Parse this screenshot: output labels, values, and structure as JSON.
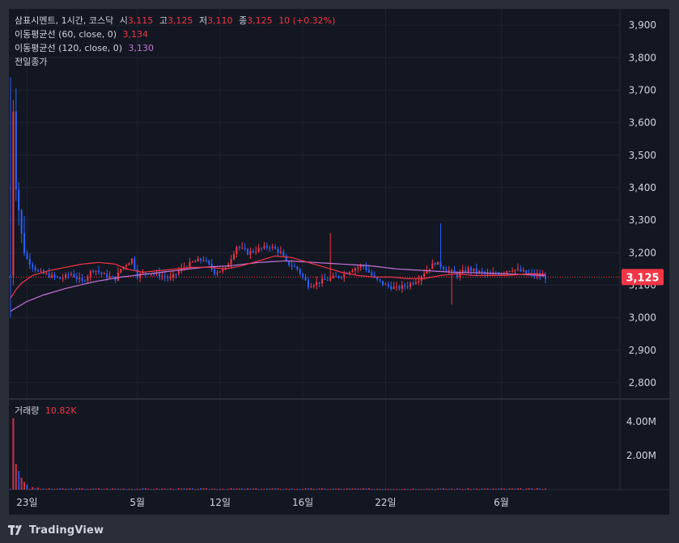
{
  "header": {
    "symbol_line": "삼표시멘트, 1시간, 코스닥",
    "open_label": "시",
    "open_value": "3,115",
    "high_label": "고",
    "high_value": "3,125",
    "low_label": "저",
    "low_value": "3,110",
    "close_label": "종",
    "close_value": "3,125",
    "change": "10 (+0.32%)"
  },
  "indicators": {
    "ma60_label": "이동평균선 (60, close, 0)",
    "ma60_value": "3,134",
    "ma120_label": "이동평균선 (120, close, 0)",
    "ma120_value": "3,130",
    "prev_close_label": "전일종가"
  },
  "volume": {
    "label": "거래량",
    "value": "10.82K"
  },
  "branding": {
    "name": "TradingView"
  },
  "colors": {
    "up": "#f23645",
    "down": "#2962ff",
    "ma60": "#f23645",
    "ma120": "#c573d9"
  },
  "chart_data": {
    "type": "candlestick",
    "price_axis": {
      "ticks": [
        "3,900",
        "3,800",
        "3,700",
        "3,600",
        "3,500",
        "3,400",
        "3,300",
        "3,200",
        "3,100",
        "3,000",
        "2,900",
        "2,800"
      ],
      "range": [
        2750,
        3950
      ]
    },
    "current_price_label": "3,125",
    "current_price": 3125,
    "volume_axis": {
      "ticks": [
        "4.00M",
        "2.00M"
      ],
      "range": [
        0,
        5000000
      ]
    },
    "time_axis": {
      "labels": [
        "23일",
        "5월",
        "12일",
        "16일",
        "22일",
        "6월"
      ]
    },
    "key_levels": {
      "prev_close": 3125
    },
    "price_path": [
      [
        0,
        3130
      ],
      [
        1,
        3650
      ],
      [
        2,
        3420
      ],
      [
        4,
        3250
      ],
      [
        6,
        3180
      ],
      [
        10,
        3140
      ],
      [
        14,
        3130
      ],
      [
        18,
        3120
      ],
      [
        22,
        3135
      ],
      [
        26,
        3110
      ],
      [
        30,
        3150
      ],
      [
        34,
        3130
      ],
      [
        38,
        3120
      ],
      [
        40,
        3150
      ],
      [
        44,
        3180
      ],
      [
        46,
        3130
      ],
      [
        50,
        3140
      ],
      [
        54,
        3130
      ],
      [
        58,
        3120
      ],
      [
        62,
        3150
      ],
      [
        66,
        3170
      ],
      [
        70,
        3180
      ],
      [
        74,
        3140
      ],
      [
        78,
        3150
      ],
      [
        82,
        3220
      ],
      [
        86,
        3200
      ],
      [
        90,
        3210
      ],
      [
        94,
        3220
      ],
      [
        98,
        3200
      ],
      [
        100,
        3170
      ],
      [
        104,
        3150
      ],
      [
        108,
        3100
      ],
      [
        112,
        3110
      ],
      [
        116,
        3120
      ],
      [
        120,
        3130
      ],
      [
        124,
        3150
      ],
      [
        128,
        3160
      ],
      [
        132,
        3120
      ],
      [
        136,
        3100
      ],
      [
        140,
        3090
      ],
      [
        144,
        3100
      ],
      [
        148,
        3120
      ],
      [
        150,
        3140
      ],
      [
        154,
        3170
      ],
      [
        158,
        3150
      ],
      [
        162,
        3130
      ],
      [
        166,
        3150
      ],
      [
        170,
        3140
      ],
      [
        174,
        3130
      ],
      [
        178,
        3140
      ],
      [
        182,
        3150
      ],
      [
        186,
        3140
      ],
      [
        190,
        3130
      ],
      [
        194,
        3125
      ]
    ],
    "ma60_path": [
      [
        0,
        3060
      ],
      [
        3,
        3100
      ],
      [
        8,
        3130
      ],
      [
        14,
        3145
      ],
      [
        20,
        3155
      ],
      [
        26,
        3165
      ],
      [
        32,
        3170
      ],
      [
        38,
        3165
      ],
      [
        42,
        3150
      ],
      [
        48,
        3140
      ],
      [
        54,
        3145
      ],
      [
        60,
        3150
      ],
      [
        66,
        3155
      ],
      [
        72,
        3155
      ],
      [
        78,
        3150
      ],
      [
        84,
        3160
      ],
      [
        90,
        3175
      ],
      [
        96,
        3190
      ],
      [
        102,
        3185
      ],
      [
        108,
        3170
      ],
      [
        114,
        3155
      ],
      [
        120,
        3140
      ],
      [
        126,
        3130
      ],
      [
        132,
        3125
      ],
      [
        138,
        3125
      ],
      [
        144,
        3120
      ],
      [
        150,
        3120
      ],
      [
        156,
        3130
      ],
      [
        162,
        3135
      ],
      [
        168,
        3130
      ],
      [
        174,
        3130
      ],
      [
        180,
        3130
      ],
      [
        188,
        3135
      ],
      [
        194,
        3134
      ]
    ],
    "ma120_path": [
      [
        0,
        3020
      ],
      [
        6,
        3050
      ],
      [
        12,
        3070
      ],
      [
        20,
        3090
      ],
      [
        30,
        3110
      ],
      [
        40,
        3125
      ],
      [
        50,
        3135
      ],
      [
        60,
        3145
      ],
      [
        70,
        3155
      ],
      [
        80,
        3160
      ],
      [
        90,
        3170
      ],
      [
        100,
        3175
      ],
      [
        110,
        3170
      ],
      [
        120,
        3165
      ],
      [
        130,
        3160
      ],
      [
        140,
        3150
      ],
      [
        150,
        3145
      ],
      [
        160,
        3140
      ],
      [
        170,
        3138
      ],
      [
        180,
        3135
      ],
      [
        188,
        3132
      ],
      [
        194,
        3130
      ]
    ],
    "volume_spikes": [
      [
        1,
        4200000
      ],
      [
        2,
        1500000
      ],
      [
        3,
        1100000
      ],
      [
        4,
        700000
      ],
      [
        5,
        450000
      ],
      [
        6,
        300000
      ],
      [
        8,
        150000
      ],
      [
        10,
        120000
      ]
    ],
    "volume_base": 60000
  }
}
